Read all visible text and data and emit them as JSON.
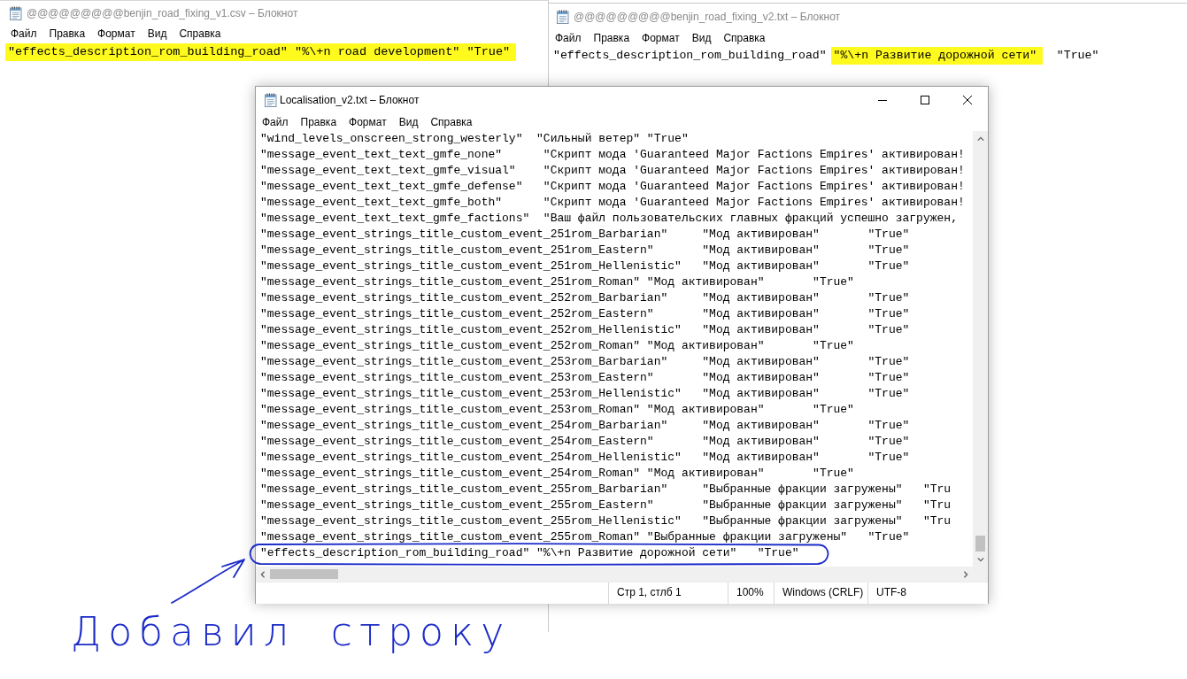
{
  "back_windows": [
    {
      "title": "@@@@@@@@@benjin_road_fixing_v1.csv – Блокнот",
      "active": false,
      "menu": [
        "Файл",
        "Правка",
        "Формат",
        "Вид",
        "Справка"
      ],
      "line": [
        {
          "text": "\"effects_description_rom_building_road\" \"%\\+n road development\" \"True\"",
          "highlighted": true
        }
      ]
    },
    {
      "title": "@@@@@@@@@benjin_road_fixing_v2.txt – Блокнот",
      "active": false,
      "menu": [
        "Файл",
        "Правка",
        "Формат",
        "Вид",
        "Справка"
      ],
      "line": [
        {
          "text": "\"effects_description_rom_building_road\"",
          "highlighted": false
        },
        {
          "text": "\"%\\+n Развитие дорожной сети\"",
          "highlighted": true
        },
        {
          "text": "\"True\"",
          "highlighted": false
        }
      ]
    }
  ],
  "main_window": {
    "title": "Localisation_v2.txt – Блокнот",
    "active": true,
    "menu": [
      "Файл",
      "Правка",
      "Формат",
      "Вид",
      "Справка"
    ],
    "lines": [
      {
        "text": "\"wind_levels_onscreen_strong_westerly\"  \"Сильный ветер\" \"True\"",
        "circled": false
      },
      {
        "text": "\"message_event_text_text_gmfe_none\"      \"Скрипт мода 'Guaranteed Major Factions Empires' активирован!",
        "circled": false
      },
      {
        "text": "\"message_event_text_text_gmfe_visual\"    \"Скрипт мода 'Guaranteed Major Factions Empires' активирован!",
        "circled": false
      },
      {
        "text": "\"message_event_text_text_gmfe_defense\"   \"Скрипт мода 'Guaranteed Major Factions Empires' активирован!",
        "circled": false
      },
      {
        "text": "\"message_event_text_text_gmfe_both\"      \"Скрипт мода 'Guaranteed Major Factions Empires' активирован!",
        "circled": false
      },
      {
        "text": "\"message_event_text_text_gmfe_factions\"  \"Ваш файл пользовательских главных фракций успешно загружен,",
        "circled": false
      },
      {
        "text": "\"message_event_strings_title_custom_event_251rom_Barbarian\"     \"Мод активирован\"       \"True\"",
        "circled": false
      },
      {
        "text": "\"message_event_strings_title_custom_event_251rom_Eastern\"       \"Мод активирован\"       \"True\"",
        "circled": false
      },
      {
        "text": "\"message_event_strings_title_custom_event_251rom_Hellenistic\"   \"Мод активирован\"       \"True\"",
        "circled": false
      },
      {
        "text": "\"message_event_strings_title_custom_event_251rom_Roman\" \"Мод активирован\"       \"True\"",
        "circled": false
      },
      {
        "text": "\"message_event_strings_title_custom_event_252rom_Barbarian\"     \"Мод активирован\"       \"True\"",
        "circled": false
      },
      {
        "text": "\"message_event_strings_title_custom_event_252rom_Eastern\"       \"Мод активирован\"       \"True\"",
        "circled": false
      },
      {
        "text": "\"message_event_strings_title_custom_event_252rom_Hellenistic\"   \"Мод активирован\"       \"True\"",
        "circled": false
      },
      {
        "text": "\"message_event_strings_title_custom_event_252rom_Roman\" \"Мод активирован\"       \"True\"",
        "circled": false
      },
      {
        "text": "\"message_event_strings_title_custom_event_253rom_Barbarian\"     \"Мод активирован\"       \"True\"",
        "circled": false
      },
      {
        "text": "\"message_event_strings_title_custom_event_253rom_Eastern\"       \"Мод активирован\"       \"True\"",
        "circled": false
      },
      {
        "text": "\"message_event_strings_title_custom_event_253rom_Hellenistic\"   \"Мод активирован\"       \"True\"",
        "circled": false
      },
      {
        "text": "\"message_event_strings_title_custom_event_253rom_Roman\" \"Мод активирован\"       \"True\"",
        "circled": false
      },
      {
        "text": "\"message_event_strings_title_custom_event_254rom_Barbarian\"     \"Мод активирован\"       \"True\"",
        "circled": false
      },
      {
        "text": "\"message_event_strings_title_custom_event_254rom_Eastern\"       \"Мод активирован\"       \"True\"",
        "circled": false
      },
      {
        "text": "\"message_event_strings_title_custom_event_254rom_Hellenistic\"   \"Мод активирован\"       \"True\"",
        "circled": false
      },
      {
        "text": "\"message_event_strings_title_custom_event_254rom_Roman\" \"Мод активирован\"       \"True\"",
        "circled": false
      },
      {
        "text": "\"message_event_strings_title_custom_event_255rom_Barbarian\"     \"Выбранные фракции загружены\"   \"Tru",
        "circled": false
      },
      {
        "text": "\"message_event_strings_title_custom_event_255rom_Eastern\"       \"Выбранные фракции загружены\"   \"Tru",
        "circled": false
      },
      {
        "text": "\"message_event_strings_title_custom_event_255rom_Hellenistic\"   \"Выбранные фракции загружены\"   \"Tru",
        "circled": false
      },
      {
        "text": "\"message_event_strings_title_custom_event_255rom_Roman\" \"Выбранные фракции загружены\"   \"True\"",
        "circled": false
      },
      {
        "text": "\"effects_description_rom_building_road\" \"%\\+n Развитие дорожной сети\"   \"True\"",
        "circled": true
      }
    ],
    "status_bar": {
      "position": "Стр 1, стлб 1",
      "zoom": "100%",
      "line_endings": "Windows (CRLF)",
      "encoding": "UTF-8"
    }
  },
  "annotation": {
    "note": "Добавил строку"
  }
}
